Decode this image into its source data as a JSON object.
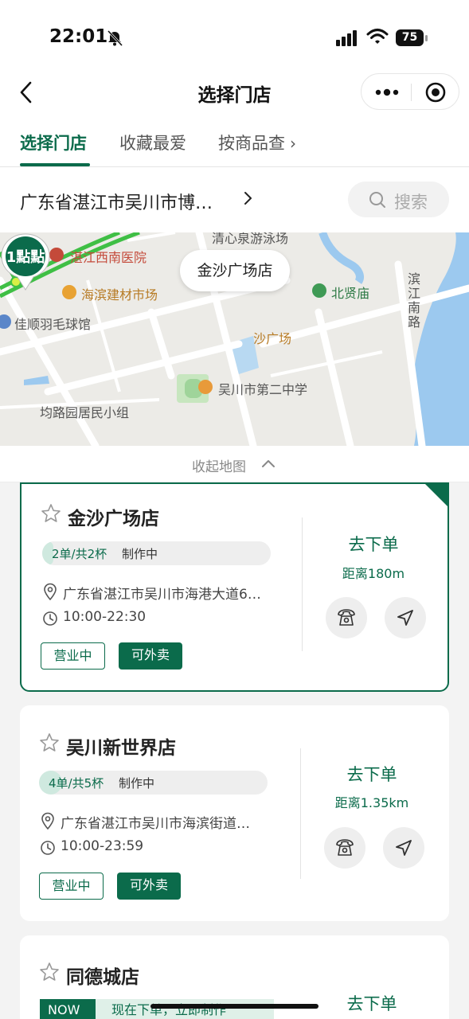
{
  "status_bar": {
    "time": "22:01",
    "battery": "75"
  },
  "nav": {
    "title": "选择门店"
  },
  "tabs": [
    {
      "label": "选择门店",
      "active": true
    },
    {
      "label": "收藏最爱",
      "active": false
    },
    {
      "label": "按商品查",
      "active": false
    }
  ],
  "location": {
    "text": "广东省湛江市吴川市博…",
    "search_label": "搜索"
  },
  "map": {
    "selected_store": "金沙广场店",
    "pin_logo": "1點點",
    "labels": {
      "pool": "清心泉游泳场",
      "hospital": "湛江西南医院",
      "market": "海滨建材市场",
      "beixian": "北贤庙",
      "badminton": "佳顺羽毛球馆",
      "plaza": "沙广场",
      "school": "吴川市第二中学",
      "residential": "均路园居民小组",
      "road": "滨江南路"
    }
  },
  "collapse_label": "收起地图",
  "stores": [
    {
      "name": "金沙广场店",
      "queue": "2单/共2杯",
      "queue_progress": 0.05,
      "status": "制作中",
      "address": "广东省湛江市吴川市海港大道6…",
      "hours": "10:00-22:30",
      "tags": [
        "营业中",
        "可外卖"
      ],
      "order_label": "去下单",
      "distance": "距离180m",
      "selected": true
    },
    {
      "name": "吴川新世界店",
      "queue": "4单/共5杯",
      "queue_progress": 0.1,
      "status": "制作中",
      "address": "广东省湛江市吴川市海滨街道…",
      "hours": "10:00-23:59",
      "tags": [
        "营业中",
        "可外卖"
      ],
      "order_label": "去下单",
      "distance": "距离1.35km",
      "selected": false
    },
    {
      "name": "同德城店",
      "now_badge": "NOW",
      "promo": "现在下单，立即制作",
      "order_label": "去下单"
    }
  ],
  "colors": {
    "brand": "#0b6b4b",
    "brand_light": "#cfe9df"
  }
}
